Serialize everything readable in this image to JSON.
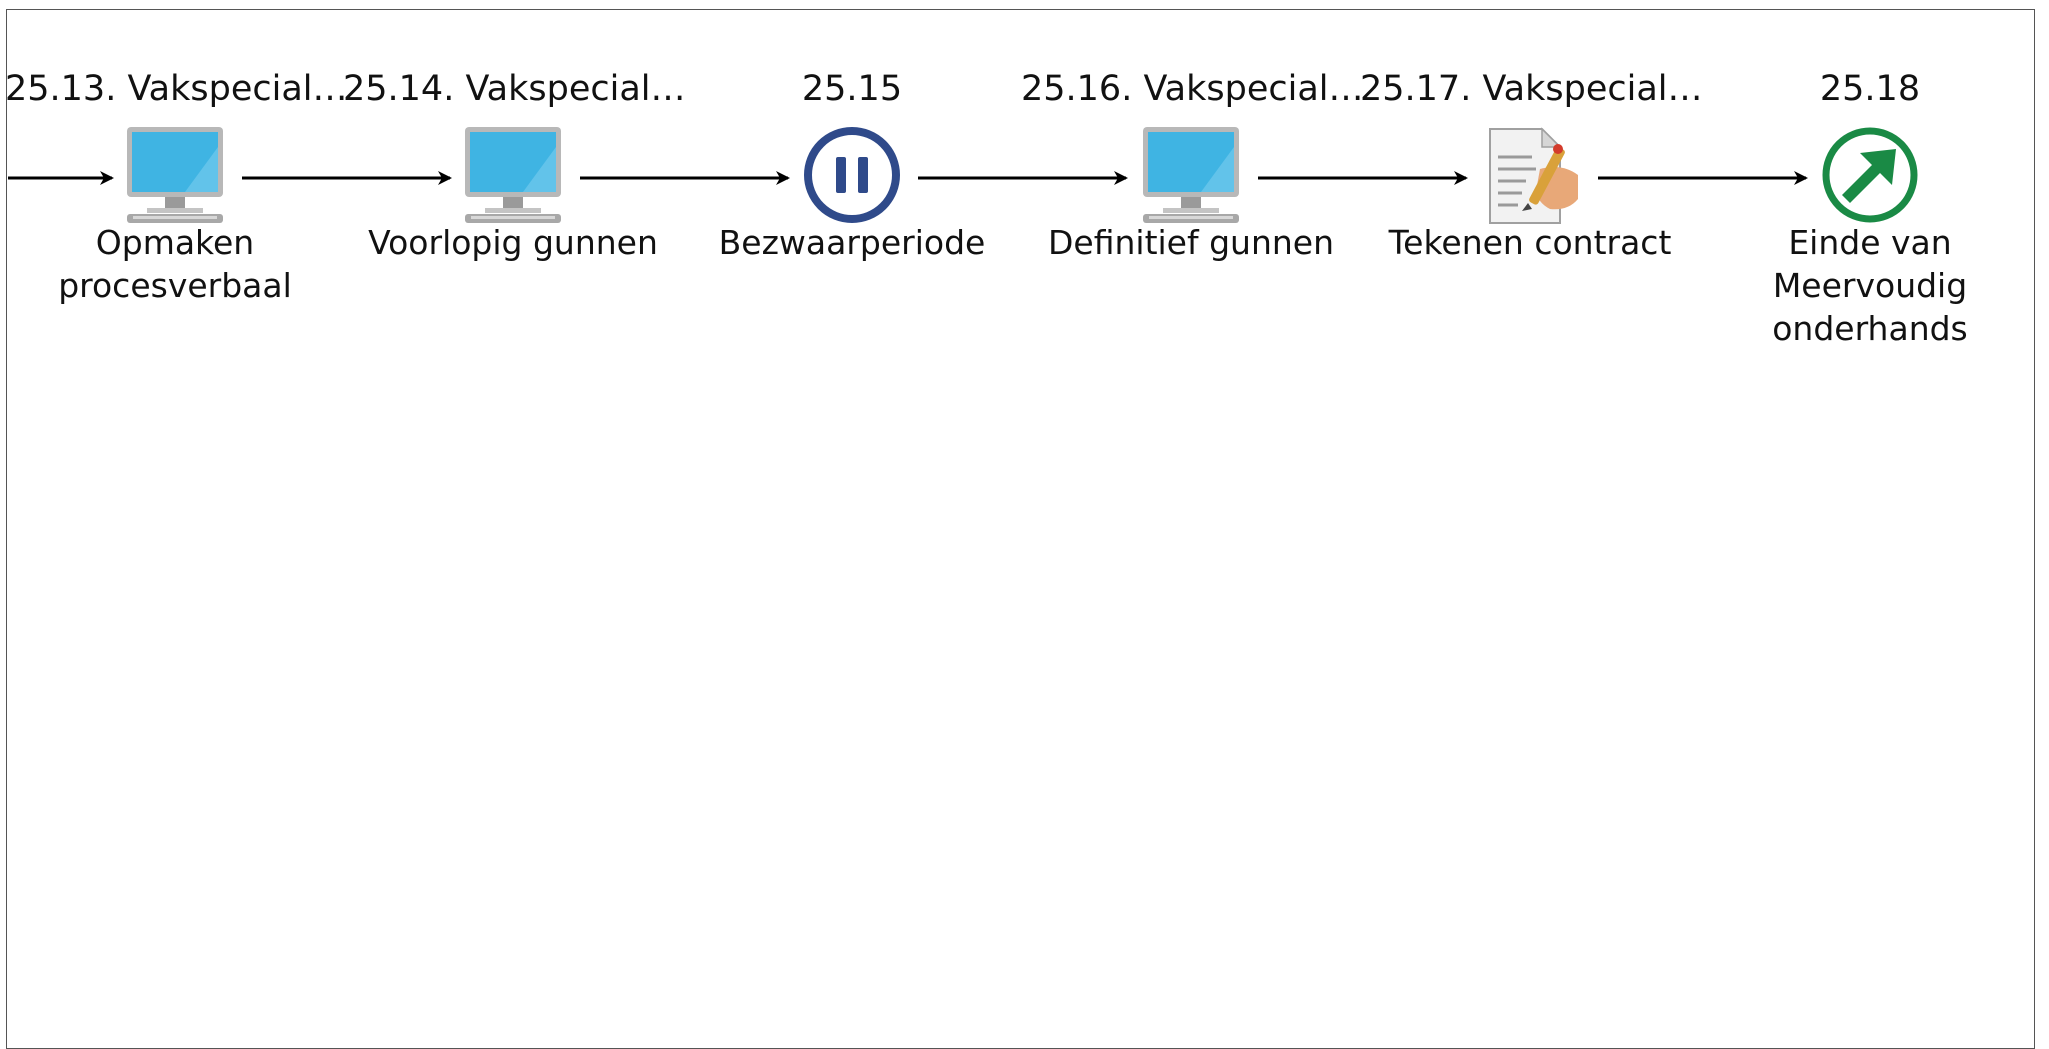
{
  "steps": [
    {
      "number": "25.13. Vakspecial…",
      "label": "Opmaken procesverbaal",
      "icon": "computer-icon"
    },
    {
      "number": "25.14. Vakspecial…",
      "label": "Voorlopig gunnen",
      "icon": "computer-icon"
    },
    {
      "number": "25.15",
      "label": "Bezwaarperiode",
      "icon": "pause-icon"
    },
    {
      "number": "25.16. Vakspecial…",
      "label": "Definitief gunnen",
      "icon": "computer-icon"
    },
    {
      "number": "25.17. Vakspecial…",
      "label": "Tekenen contract",
      "icon": "signing-document-icon"
    },
    {
      "number": "25.18",
      "label": "Einde van Meervoudig onderhands",
      "icon": "end-exit-icon"
    }
  ],
  "colors": {
    "pause_ring": "#2f4a8a",
    "end_ring": "#1a8a45",
    "screen": "#3fb4e3",
    "arrow": "#000000"
  }
}
